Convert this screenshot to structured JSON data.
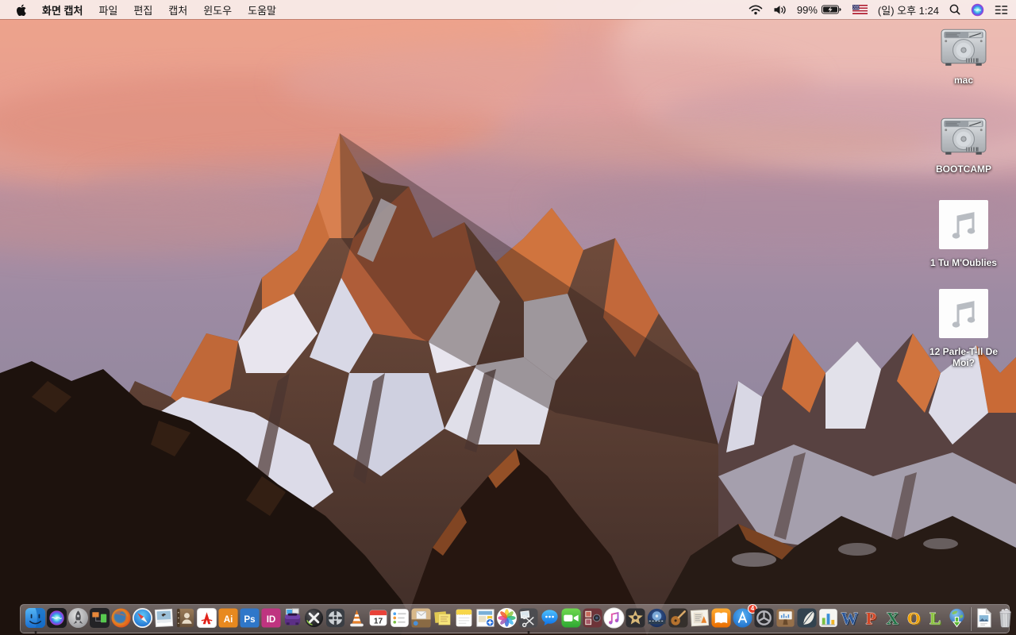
{
  "menu_bar": {
    "app_name": "화면 캡처",
    "menus": [
      "파일",
      "편집",
      "캡처",
      "윈도우",
      "도움말"
    ],
    "status": {
      "battery_percent": "99%",
      "clock": "(일) 오후 1:24"
    }
  },
  "desktop": {
    "icons": [
      {
        "kind": "hard-drive",
        "label": "mac"
      },
      {
        "kind": "hard-drive",
        "label": "BOOTCAMP"
      },
      {
        "kind": "audio-file",
        "label": "1 Tu M'Oublies"
      },
      {
        "kind": "audio-file",
        "label": "12 Parle-T-Il De Moi?"
      }
    ]
  },
  "dock": {
    "apps": [
      {
        "name": "finder",
        "kind": "finder",
        "running": true
      },
      {
        "name": "siri",
        "kind": "siri"
      },
      {
        "name": "launchpad",
        "kind": "launchpad"
      },
      {
        "name": "display-windows-app",
        "kind": "displayapp"
      },
      {
        "name": "firefox",
        "kind": "firefox"
      },
      {
        "name": "safari",
        "kind": "safari"
      },
      {
        "name": "image-viewer",
        "kind": "imageviewer"
      },
      {
        "name": "contacts",
        "kind": "contacts"
      },
      {
        "name": "acrobat-reader",
        "kind": "acrobat"
      },
      {
        "name": "illustrator",
        "kind": "adobe",
        "glyph": "Ai",
        "bg": "#e8891f"
      },
      {
        "name": "photoshop",
        "kind": "adobe",
        "glyph": "Ps",
        "bg": "#2f77c9"
      },
      {
        "name": "indesign",
        "kind": "adobe",
        "glyph": "ID",
        "bg": "#bf3480"
      },
      {
        "name": "toast",
        "kind": "toast"
      },
      {
        "name": "x-media-app",
        "kind": "xsphere"
      },
      {
        "name": "disk-tool",
        "kind": "disktool"
      },
      {
        "name": "vlc",
        "kind": "vlc"
      },
      {
        "name": "calendar",
        "kind": "calendar",
        "glyph": "17"
      },
      {
        "name": "reminders",
        "kind": "reminders"
      },
      {
        "name": "mail-app",
        "kind": "maildesk"
      },
      {
        "name": "stickies",
        "kind": "stickies"
      },
      {
        "name": "notes",
        "kind": "notes"
      },
      {
        "name": "iweb",
        "kind": "iweb"
      },
      {
        "name": "photos",
        "kind": "photos"
      },
      {
        "name": "screen-capture",
        "kind": "grab",
        "running": true
      },
      {
        "name": "messages",
        "kind": "messages"
      },
      {
        "name": "facetime",
        "kind": "facetime"
      },
      {
        "name": "photo-booth",
        "kind": "photobooth"
      },
      {
        "name": "itunes",
        "kind": "itunes"
      },
      {
        "name": "imovie",
        "kind": "imovie"
      },
      {
        "name": "idvd",
        "kind": "idvd"
      },
      {
        "name": "garageband",
        "kind": "garageband"
      },
      {
        "name": "clippings-app",
        "kind": "clippings"
      },
      {
        "name": "ibooks",
        "kind": "ibooks"
      },
      {
        "name": "app-store",
        "kind": "appstore",
        "badge": "4"
      },
      {
        "name": "aperture",
        "kind": "aperture"
      },
      {
        "name": "keynote",
        "kind": "keynote"
      },
      {
        "name": "pages",
        "kind": "pages"
      },
      {
        "name": "numbers",
        "kind": "numbers"
      },
      {
        "name": "word",
        "kind": "letter",
        "glyph": "W",
        "color": "#2b579a",
        "dark": "#16355f"
      },
      {
        "name": "powerpoint",
        "kind": "letter",
        "glyph": "P",
        "color": "#d24726",
        "dark": "#8f2c12"
      },
      {
        "name": "excel",
        "kind": "letter",
        "glyph": "X",
        "color": "#217346",
        "dark": "#124a2a"
      },
      {
        "name": "outlook",
        "kind": "letter",
        "glyph": "O",
        "color": "#f0a30a",
        "dark": "#a86f00"
      },
      {
        "name": "lync",
        "kind": "letter",
        "glyph": "L",
        "color": "#8dc63f",
        "dark": "#588a17"
      },
      {
        "name": "autoupdate-globe",
        "kind": "globe"
      }
    ],
    "files": [
      {
        "name": "document-file",
        "kind": "docfile"
      }
    ],
    "trash": {
      "name": "trash",
      "kind": "trash",
      "state": "full"
    }
  },
  "colors": {
    "menu_bar_bg": "#f8ece9",
    "badge_red": "#e8402a",
    "sky_top": "#eaa795",
    "sunlit_rock": "#c96f3c",
    "snow": "#e8e5ee"
  }
}
